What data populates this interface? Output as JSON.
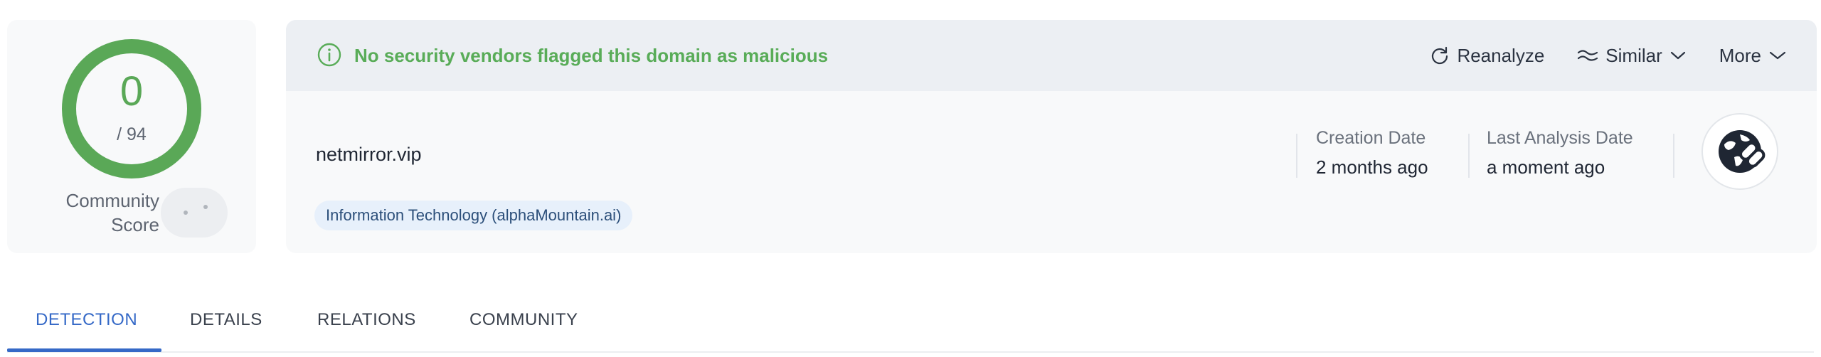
{
  "score": {
    "value": "0",
    "total": "/ 94",
    "ring_color": "#5aa857",
    "community_label_line1": "Community",
    "community_label_line2": "Score"
  },
  "banner": {
    "icon": "info-circle-icon",
    "message": "No security vendors flagged this domain as malicious",
    "message_color": "#59ac58",
    "actions": {
      "reanalyze": "Reanalyze",
      "similar": "Similar",
      "more": "More"
    }
  },
  "entity": {
    "domain": "netmirror.vip",
    "category_tag": "Information Technology (alphaMountain.ai)",
    "creation_date_label": "Creation Date",
    "creation_date_value": "2 months ago",
    "last_analysis_label": "Last Analysis Date",
    "last_analysis_value": "a moment ago",
    "type_icon": "globe-link-icon"
  },
  "tabs": {
    "detection": "DETECTION",
    "details": "DETAILS",
    "relations": "RELATIONS",
    "community": "COMMUNITY",
    "active": "DETECTION",
    "accent_color": "#3569c7"
  }
}
